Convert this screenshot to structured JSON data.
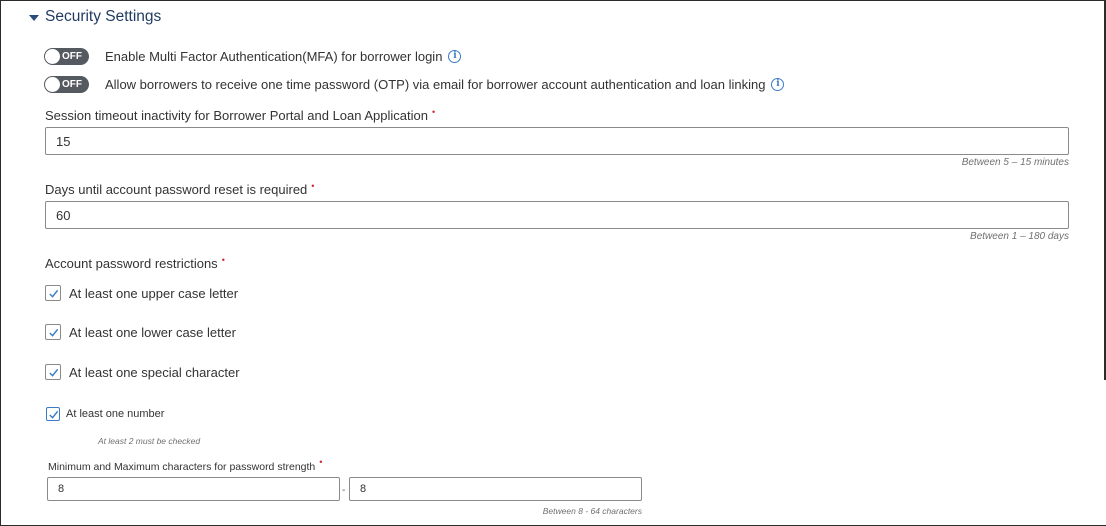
{
  "section": {
    "title": "Security Settings"
  },
  "toggles": [
    {
      "state": "OFF",
      "label": "Enable Multi Factor Authentication(MFA) for borrower login"
    },
    {
      "state": "OFF",
      "label": "Allow borrowers to receive one time password (OTP) via email for borrower account authentication and loan linking"
    }
  ],
  "session_timeout": {
    "label": "Session timeout inactivity for Borrower Portal and Loan Application",
    "required_mark": "•",
    "value": "15",
    "hint": "Between 5 – 15 minutes"
  },
  "password_reset": {
    "label": "Days until account password reset is required",
    "required_mark": "•",
    "value": "60",
    "hint": "Between 1 – 180 days"
  },
  "restrictions": {
    "label": "Account password restrictions",
    "required_mark": "•",
    "items": [
      {
        "label": "At least one upper case letter",
        "checked": true
      },
      {
        "label": "At least one lower case letter",
        "checked": true
      },
      {
        "label": "At least one special character",
        "checked": true
      },
      {
        "label": "At least one number",
        "checked": true
      }
    ],
    "hint": "At least 2 must be checked"
  },
  "password_length": {
    "label": "Minimum and Maximum characters for password strength",
    "required_mark": "•",
    "min_value": "8",
    "separator": "-",
    "max_value": "8",
    "hint": "Between 8 - 64 characters"
  },
  "colors": {
    "accent": "#3b7bc6",
    "required": "#cc2936",
    "toggle_off": "#555a60",
    "title": "#1f3a5f"
  },
  "icons": {
    "info": "info-circle-icon",
    "check": "checkmark-icon",
    "caret": "caret-down-icon"
  }
}
